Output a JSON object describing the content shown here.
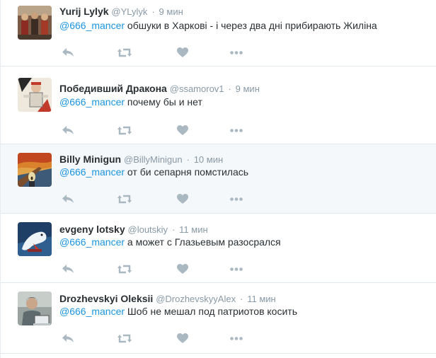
{
  "colors": {
    "mention": "#1b95e0",
    "meta": "#8899a6",
    "icon": "#aab8c2",
    "text": "#292f33"
  },
  "tweets": [
    {
      "name": "Yurij Lylyk",
      "handle": "@YLylyk",
      "time": "9 мин",
      "mention": "@666_mancer",
      "text": " обшуки в Харкові - і через два дні прибирають Жиліна",
      "avatar": "folk-ensemble-avatar",
      "highlighted": false
    },
    {
      "name": "Победивший Дракона",
      "handle": "@ssamorov1",
      "time": "9 мин",
      "mention": "@666_mancer",
      "text": " почему бы и нет",
      "avatar": "soviet-poster-avatar",
      "highlighted": false
    },
    {
      "name": "Billy Minigun",
      "handle": "@BillyMinigun",
      "time": "10 мин",
      "mention": "@666_mancer",
      "text": " от би сепарня помстилась",
      "avatar": "the-scream-avatar",
      "highlighted": true
    },
    {
      "name": "evgeny lotsky",
      "handle": "@loutskiy",
      "time": "11 мин",
      "mention": "@666_mancer",
      "text": " а может с Глазьевым разосрался",
      "avatar": "polar-bear-avatar",
      "highlighted": false
    },
    {
      "name": "Drozhevskyi Oleksii",
      "handle": "@DrozhevskyyAlex",
      "time": "11 мин",
      "mention": "@666_mancer",
      "text": " Шоб не мешал под патриотов косить",
      "avatar": "laptop-man-avatar",
      "highlighted": false
    }
  ],
  "actions": [
    "reply-icon",
    "retweet-icon",
    "like-icon",
    "more-icon"
  ]
}
